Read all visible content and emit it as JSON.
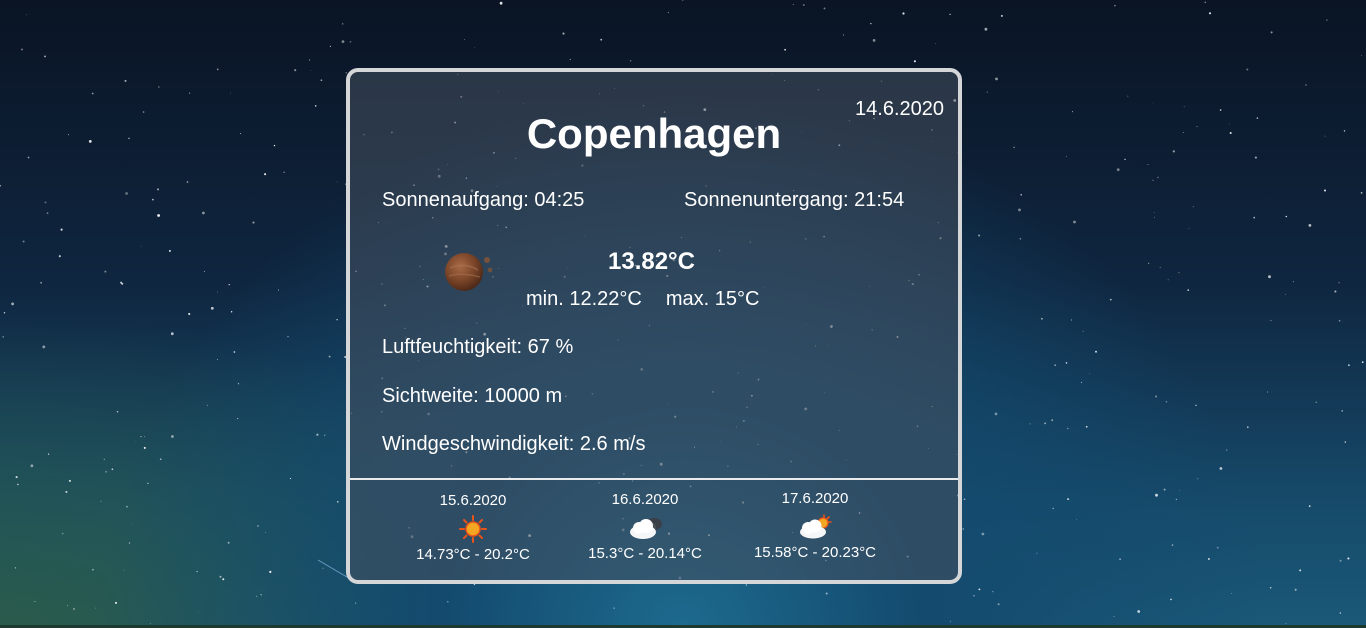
{
  "weather": {
    "date": "14.6.2020",
    "city": "Copenhagen",
    "sunrise": "Sonnenaufgang: 04:25",
    "sunset": "Sonnenuntergang: 21:54",
    "current_icon": "moon-icon",
    "temperature": "13.82°C",
    "min": "min. 12.22°C",
    "max": "max. 15°C",
    "humidity": "Luftfeuchtigkeit: 67 %",
    "visibility": "Sichtweite: 10000 m",
    "wind": "Windgeschwindigkeit: 2.6 m/s"
  },
  "forecast": [
    {
      "date": "15.6.2020",
      "icon": "sun-icon",
      "range": "14.73°C - 20.2°C"
    },
    {
      "date": "16.6.2020",
      "icon": "cloud-night-icon",
      "range": "15.3°C - 20.14°C"
    },
    {
      "date": "17.6.2020",
      "icon": "cloud-sun-icon",
      "range": "15.58°C - 20.23°C"
    }
  ],
  "colors": {
    "card_border": "#d4d6d8",
    "card_background": "rgba(70,80,95,0.55)",
    "text": "#ffffff"
  }
}
